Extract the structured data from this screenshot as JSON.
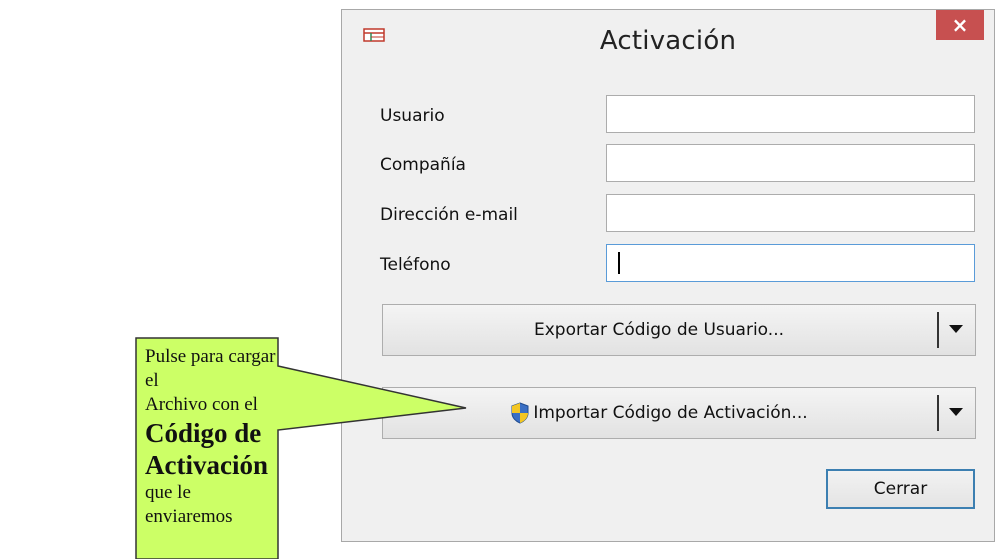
{
  "dialog": {
    "title": "Activación",
    "close_label": "×"
  },
  "fields": [
    {
      "label": "Usuario",
      "value": ""
    },
    {
      "label": "Compañía",
      "value": ""
    },
    {
      "label": "Dirección e-mail",
      "value": ""
    },
    {
      "label": "Teléfono",
      "value": ""
    }
  ],
  "buttons": {
    "export_label": "Exportar Código de Usuario...",
    "import_label": "Importar Código de Activación...",
    "close_label": "Cerrar"
  },
  "callout": {
    "line1": "Pulse para cargar el",
    "line2": "Archivo con el",
    "bold1": "Código de",
    "bold2": "Activación",
    "line3": "que le",
    "line4": "enviaremos"
  },
  "icons": {
    "app": "app-window-icon",
    "shield": "uac-shield-icon",
    "close": "close-icon",
    "dropdown": "dropdown-arrow-icon"
  },
  "colors": {
    "close_button": "#c75050",
    "callout_fill": "#ccff66",
    "focus_border": "#5a9bd8",
    "default_button_border": "#3c7fb1"
  }
}
